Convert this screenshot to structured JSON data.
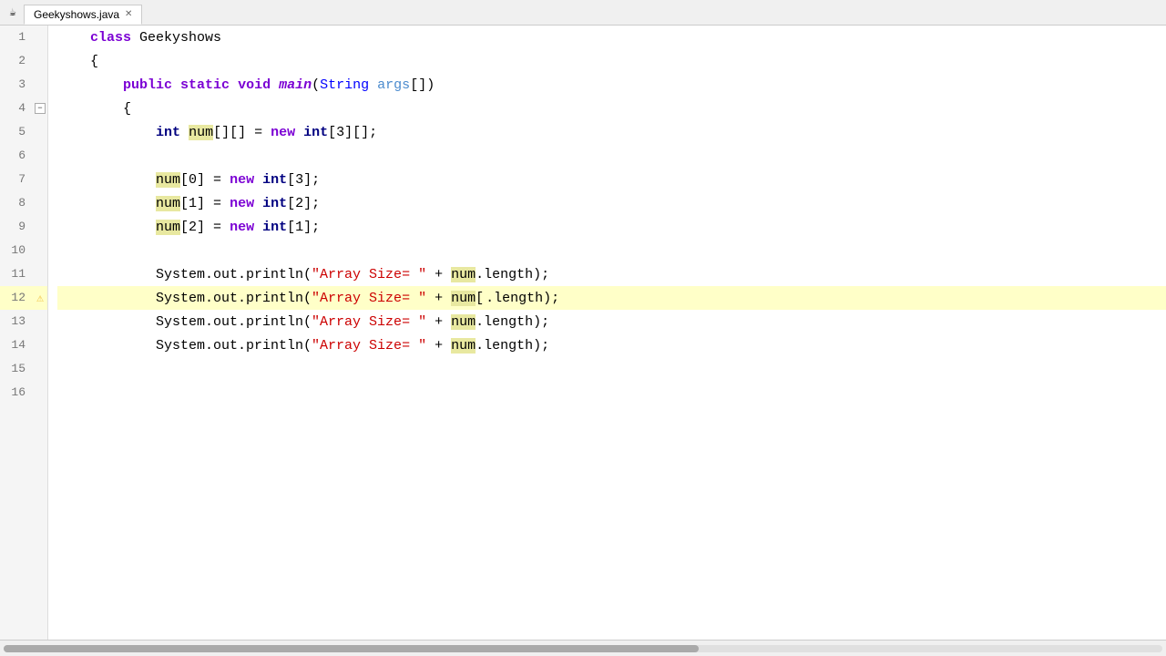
{
  "tab": {
    "filename": "Geekyshows.java",
    "close_label": "✕"
  },
  "lines": [
    {
      "num": 1,
      "fold": null,
      "warning": false,
      "highlight": false,
      "tokens": [
        {
          "t": "    ",
          "cls": "plain"
        },
        {
          "t": "class",
          "cls": "kw"
        },
        {
          "t": " Geekyshows",
          "cls": "plain"
        }
      ]
    },
    {
      "num": 2,
      "fold": null,
      "warning": false,
      "highlight": false,
      "tokens": [
        {
          "t": "    {",
          "cls": "plain"
        }
      ]
    },
    {
      "num": 3,
      "fold": null,
      "warning": false,
      "highlight": false,
      "tokens": [
        {
          "t": "        ",
          "cls": "plain"
        },
        {
          "t": "public",
          "cls": "kw"
        },
        {
          "t": " ",
          "cls": "plain"
        },
        {
          "t": "static",
          "cls": "kw"
        },
        {
          "t": " ",
          "cls": "plain"
        },
        {
          "t": "void",
          "cls": "kw"
        },
        {
          "t": " ",
          "cls": "plain"
        },
        {
          "t": "main",
          "cls": "kw-italic"
        },
        {
          "t": "(",
          "cls": "plain"
        },
        {
          "t": "String",
          "cls": "class-name"
        },
        {
          "t": " ",
          "cls": "plain"
        },
        {
          "t": "args",
          "cls": "param"
        },
        {
          "t": "[])",
          "cls": "plain"
        }
      ]
    },
    {
      "num": 4,
      "fold": "minus",
      "warning": false,
      "highlight": false,
      "tokens": [
        {
          "t": "        {",
          "cls": "plain"
        }
      ]
    },
    {
      "num": 5,
      "fold": null,
      "warning": false,
      "highlight": false,
      "tokens": [
        {
          "t": "            ",
          "cls": "plain"
        },
        {
          "t": "int",
          "cls": "type"
        },
        {
          "t": " ",
          "cls": "plain"
        },
        {
          "t": "num",
          "cls": "var-highlight"
        },
        {
          "t": "[][] = ",
          "cls": "plain"
        },
        {
          "t": "new",
          "cls": "kw"
        },
        {
          "t": " ",
          "cls": "plain"
        },
        {
          "t": "int",
          "cls": "type"
        },
        {
          "t": "[3][];",
          "cls": "plain"
        }
      ]
    },
    {
      "num": 6,
      "fold": null,
      "warning": false,
      "highlight": false,
      "tokens": [
        {
          "t": "",
          "cls": "plain"
        }
      ]
    },
    {
      "num": 7,
      "fold": null,
      "warning": false,
      "highlight": false,
      "tokens": [
        {
          "t": "            ",
          "cls": "plain"
        },
        {
          "t": "num",
          "cls": "var-highlight"
        },
        {
          "t": "[0] = ",
          "cls": "plain"
        },
        {
          "t": "new",
          "cls": "kw"
        },
        {
          "t": " ",
          "cls": "plain"
        },
        {
          "t": "int",
          "cls": "type"
        },
        {
          "t": "[3];",
          "cls": "plain"
        }
      ]
    },
    {
      "num": 8,
      "fold": null,
      "warning": false,
      "highlight": false,
      "tokens": [
        {
          "t": "            ",
          "cls": "plain"
        },
        {
          "t": "num",
          "cls": "var-highlight"
        },
        {
          "t": "[1] = ",
          "cls": "plain"
        },
        {
          "t": "new",
          "cls": "kw"
        },
        {
          "t": " ",
          "cls": "plain"
        },
        {
          "t": "int",
          "cls": "type"
        },
        {
          "t": "[2];",
          "cls": "plain"
        }
      ]
    },
    {
      "num": 9,
      "fold": null,
      "warning": false,
      "highlight": false,
      "tokens": [
        {
          "t": "            ",
          "cls": "plain"
        },
        {
          "t": "num",
          "cls": "var-highlight"
        },
        {
          "t": "[2] = ",
          "cls": "plain"
        },
        {
          "t": "new",
          "cls": "kw"
        },
        {
          "t": " ",
          "cls": "plain"
        },
        {
          "t": "int",
          "cls": "type"
        },
        {
          "t": "[1];",
          "cls": "plain"
        }
      ]
    },
    {
      "num": 10,
      "fold": null,
      "warning": false,
      "highlight": false,
      "tokens": [
        {
          "t": "",
          "cls": "plain"
        }
      ]
    },
    {
      "num": 11,
      "fold": null,
      "warning": false,
      "highlight": false,
      "tokens": [
        {
          "t": "            System.out.println(",
          "cls": "plain"
        },
        {
          "t": "\"Array Size= \"",
          "cls": "string"
        },
        {
          "t": " + ",
          "cls": "plain"
        },
        {
          "t": "num",
          "cls": "var-highlight"
        },
        {
          "t": ".length);",
          "cls": "plain"
        }
      ]
    },
    {
      "num": 12,
      "fold": null,
      "warning": true,
      "highlight": true,
      "tokens": [
        {
          "t": "            System.out.println(",
          "cls": "plain"
        },
        {
          "t": "\"Array Size= \"",
          "cls": "string"
        },
        {
          "t": " + ",
          "cls": "plain"
        },
        {
          "t": "num",
          "cls": "var-highlight"
        },
        {
          "t": "[",
          "cls": "plain"
        },
        {
          "t": "|",
          "cls": "plain"
        },
        {
          "t": ".length);",
          "cls": "plain"
        }
      ]
    },
    {
      "num": 13,
      "fold": null,
      "warning": false,
      "highlight": false,
      "tokens": [
        {
          "t": "            System.out.println(",
          "cls": "plain"
        },
        {
          "t": "\"Array Size= \"",
          "cls": "string"
        },
        {
          "t": " + ",
          "cls": "plain"
        },
        {
          "t": "num",
          "cls": "var-highlight"
        },
        {
          "t": ".length);",
          "cls": "plain"
        }
      ]
    },
    {
      "num": 14,
      "fold": null,
      "warning": false,
      "highlight": false,
      "tokens": [
        {
          "t": "            System.out.println(",
          "cls": "plain"
        },
        {
          "t": "\"Array Size= \"",
          "cls": "string"
        },
        {
          "t": " + ",
          "cls": "plain"
        },
        {
          "t": "num",
          "cls": "var-highlight"
        },
        {
          "t": ".length);",
          "cls": "plain"
        }
      ]
    },
    {
      "num": 15,
      "fold": null,
      "warning": false,
      "highlight": false,
      "tokens": [
        {
          "t": "",
          "cls": "plain"
        }
      ]
    },
    {
      "num": 16,
      "fold": null,
      "warning": false,
      "highlight": false,
      "tokens": [
        {
          "t": "",
          "cls": "plain"
        }
      ]
    }
  ],
  "icons": {
    "java_icon": "☕",
    "warning_icon": "⚠",
    "fold_minus": "−",
    "close_tab": "✕"
  }
}
